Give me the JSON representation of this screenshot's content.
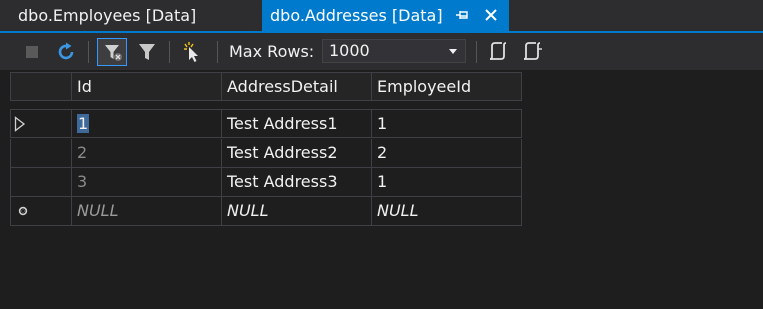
{
  "tabs": [
    {
      "label": "dbo.Employees [Data]",
      "active": false
    },
    {
      "label": "dbo.Addresses [Data]",
      "active": true
    }
  ],
  "toolbar": {
    "max_rows_label": "Max Rows:",
    "max_rows_value": "1000",
    "icons": [
      "stop-icon",
      "refresh-icon",
      "filter-toggle-icon",
      "filter-icon",
      "select-icon",
      "script-icon",
      "script-file-icon"
    ]
  },
  "grid": {
    "columns": [
      "Id",
      "AddressDetail",
      "EmployeeId"
    ],
    "rows": [
      {
        "Id": "1",
        "AddressDetail": "Test Address1",
        "EmployeeId": "1"
      },
      {
        "Id": "2",
        "AddressDetail": "Test Address2",
        "EmployeeId": "2"
      },
      {
        "Id": "3",
        "AddressDetail": "Test Address3",
        "EmployeeId": "1"
      }
    ],
    "new_row": {
      "Id": "NULL",
      "AddressDetail": "NULL",
      "EmployeeId": "NULL"
    }
  },
  "colors": {
    "accent": "#007acc",
    "background": "#1e1e1e"
  }
}
